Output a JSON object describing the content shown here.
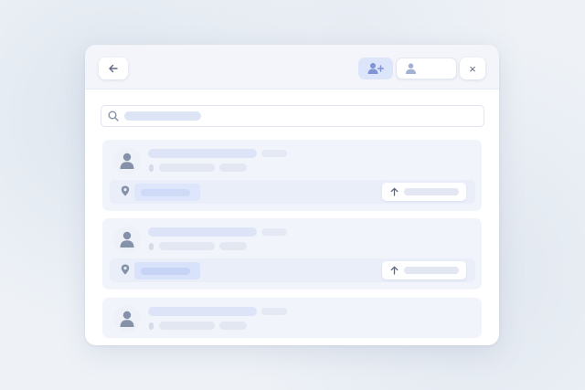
{
  "header": {
    "back_icon": "arrow-left-icon",
    "add_icon": "user-plus-icon",
    "profile_icon": "user-icon",
    "close_label": "×"
  },
  "search": {
    "icon": "search-icon",
    "placeholder": ""
  },
  "cards": [
    {
      "has_location_row": true
    },
    {
      "has_location_row": true
    },
    {
      "has_location_row": false
    }
  ],
  "colors": {
    "accent": "#7f93d6",
    "icon_gray": "#8591a8",
    "skeleton": "#e3e8f3",
    "skeleton_strong": "#dde4f7",
    "card_bg": "#f1f4fb"
  }
}
